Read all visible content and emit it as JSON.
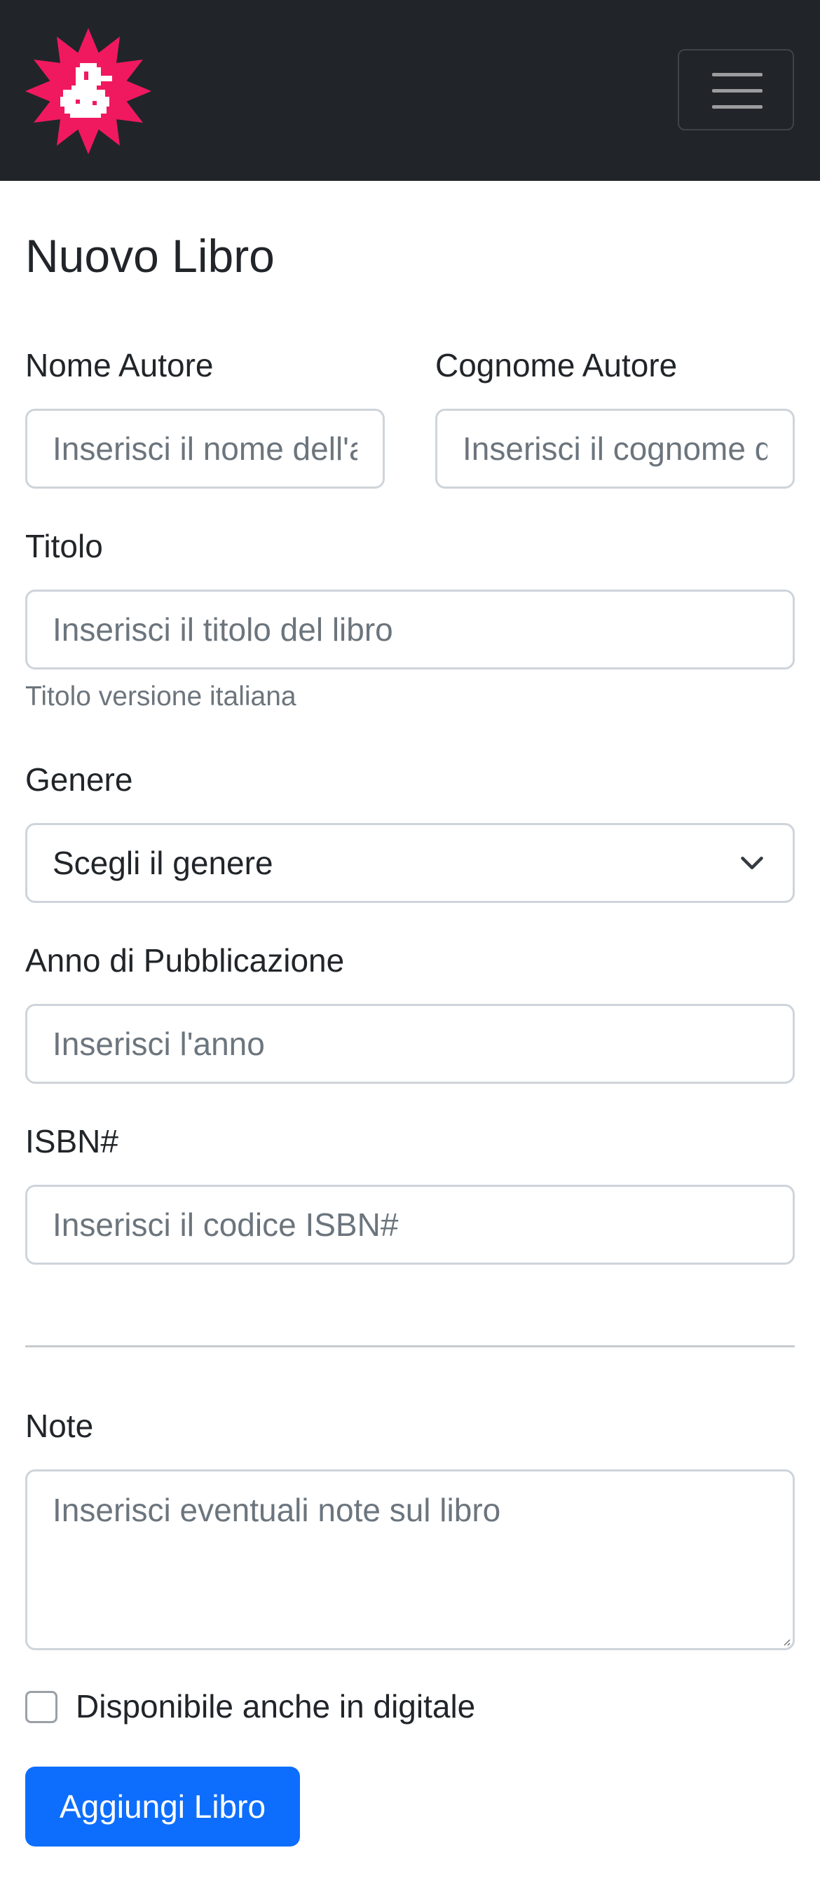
{
  "colors": {
    "navbar_bg": "#212529",
    "logo_pink": "#f0195f",
    "primary": "#0d6efd",
    "border": "#ced4da",
    "muted_text": "#6c757d"
  },
  "navbar": {
    "logo_icon": "duck-badge-logo-icon",
    "toggler_icon": "hamburger-menu-icon"
  },
  "page": {
    "title": "Nuovo Libro"
  },
  "form": {
    "author_first_name": {
      "label": "Nome Autore",
      "placeholder": "Inserisci il nome dell'autore",
      "value": ""
    },
    "author_last_name": {
      "label": "Cognome Autore",
      "placeholder": "Inserisci il cognome dell'autore",
      "value": ""
    },
    "title": {
      "label": "Titolo",
      "placeholder": "Inserisci il titolo del libro",
      "value": "",
      "help": "Titolo versione italiana"
    },
    "genre": {
      "label": "Genere",
      "selected": "Scegli il genere",
      "icon": "chevron-down-icon"
    },
    "year": {
      "label": "Anno di Pubblicazione",
      "placeholder": "Inserisci l'anno",
      "value": ""
    },
    "isbn": {
      "label": "ISBN#",
      "placeholder": "Inserisci il codice ISBN#",
      "value": ""
    },
    "notes": {
      "label": "Note",
      "placeholder": "Inserisci eventuali note sul libro",
      "value": ""
    },
    "digital": {
      "label": "Disponibile anche in digitale",
      "checked": false
    },
    "submit_label": "Aggiungi Libro"
  }
}
